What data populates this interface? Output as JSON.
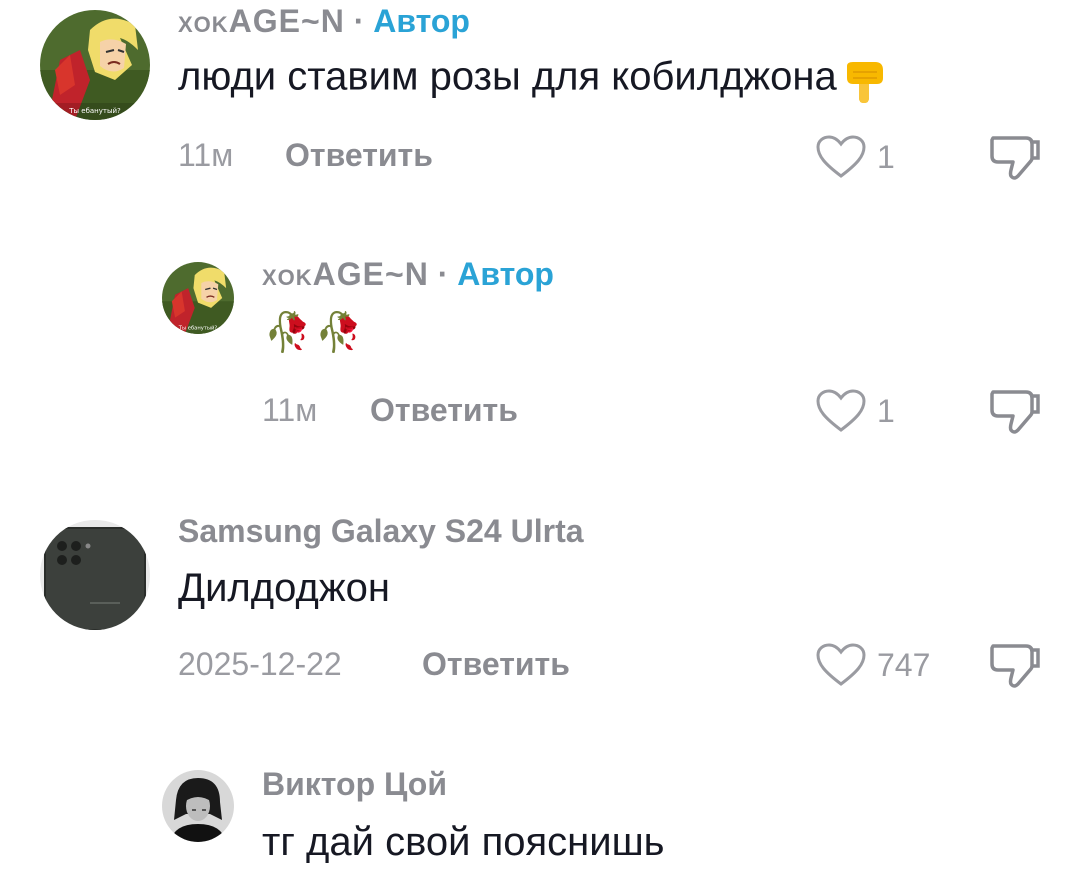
{
  "comments": [
    {
      "username": "xoκAGE~N",
      "separator": "·",
      "author_tag": "Автор",
      "text": "люди ставим розы для кобилджона",
      "emoji": "point-down-emoji",
      "time": "11м",
      "reply_label": "Ответить",
      "likes": "1",
      "avatar_caption": "Ты ебанутый?"
    },
    {
      "username": "xoκAGE~N",
      "separator": "·",
      "author_tag": "Автор",
      "text": "🥀🥀",
      "time": "11м",
      "reply_label": "Ответить",
      "likes": "1",
      "avatar_caption": "Ты ебанутый?"
    },
    {
      "username": "Samsung Galaxy S24 Ulrta",
      "text": "Дилдоджон",
      "time": "2025-12-22",
      "reply_label": "Ответить",
      "likes": "747"
    },
    {
      "username": "Виктор Цой",
      "text": "тг дай свой пояснишь"
    }
  ],
  "icons": {
    "like": "heart-outline-icon",
    "dislike": "thumbs-down-icon"
  },
  "colors": {
    "author_accent": "#2aa3d6",
    "secondary_text": "#8a8b91",
    "primary_text": "#161823"
  }
}
